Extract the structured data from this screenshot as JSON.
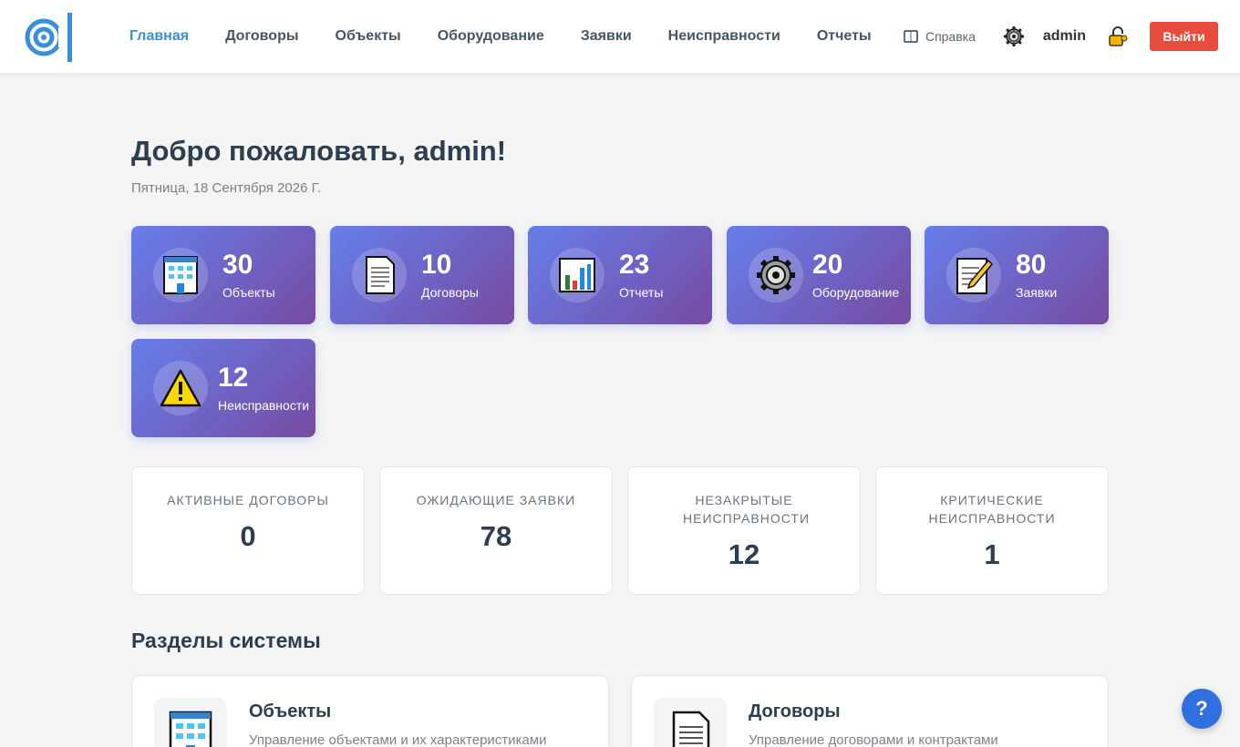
{
  "header": {
    "nav": [
      {
        "label": "Главная",
        "active": true
      },
      {
        "label": "Договоры"
      },
      {
        "label": "Объекты"
      },
      {
        "label": "Оборудование"
      },
      {
        "label": "Заявки"
      },
      {
        "label": "Неисправности"
      },
      {
        "label": "Отчеты"
      }
    ],
    "help_label": "Справка",
    "username": "admin",
    "logout_label": "Выйти"
  },
  "welcome": {
    "title": "Добро пожаловать, admin!",
    "date": "Пятница, 18 Сентября 2026 Г."
  },
  "stats": [
    {
      "value": "30",
      "label": "Объекты",
      "icon": "building-icon"
    },
    {
      "value": "10",
      "label": "Договоры",
      "icon": "document-icon"
    },
    {
      "value": "23",
      "label": "Отчеты",
      "icon": "bar-chart-icon"
    },
    {
      "value": "20",
      "label": "Оборудование",
      "icon": "gear-icon"
    },
    {
      "value": "80",
      "label": "Заявки",
      "icon": "memo-icon"
    },
    {
      "value": "12",
      "label": "Неисправности",
      "icon": "warning-icon"
    }
  ],
  "summary": [
    {
      "title": "Активные договоры",
      "value": "0"
    },
    {
      "title": "Ожидающие заявки",
      "value": "78"
    },
    {
      "title": "Незакрытые неисправности",
      "value": "12"
    },
    {
      "title": "Критические неисправности",
      "value": "1"
    }
  ],
  "sections": {
    "title": "Разделы системы",
    "items": [
      {
        "title": "Объекты",
        "desc": "Управление объектами и их характеристиками",
        "icon": "building-icon"
      },
      {
        "title": "Договоры",
        "desc": "Управление договорами и контрактами",
        "icon": "document-icon"
      }
    ]
  },
  "help_fab": "?",
  "colors": {
    "accent": "#3a8fd6",
    "gradient_start": "#667eea",
    "gradient_end": "#764ba2",
    "logout": "#e74c3c"
  }
}
